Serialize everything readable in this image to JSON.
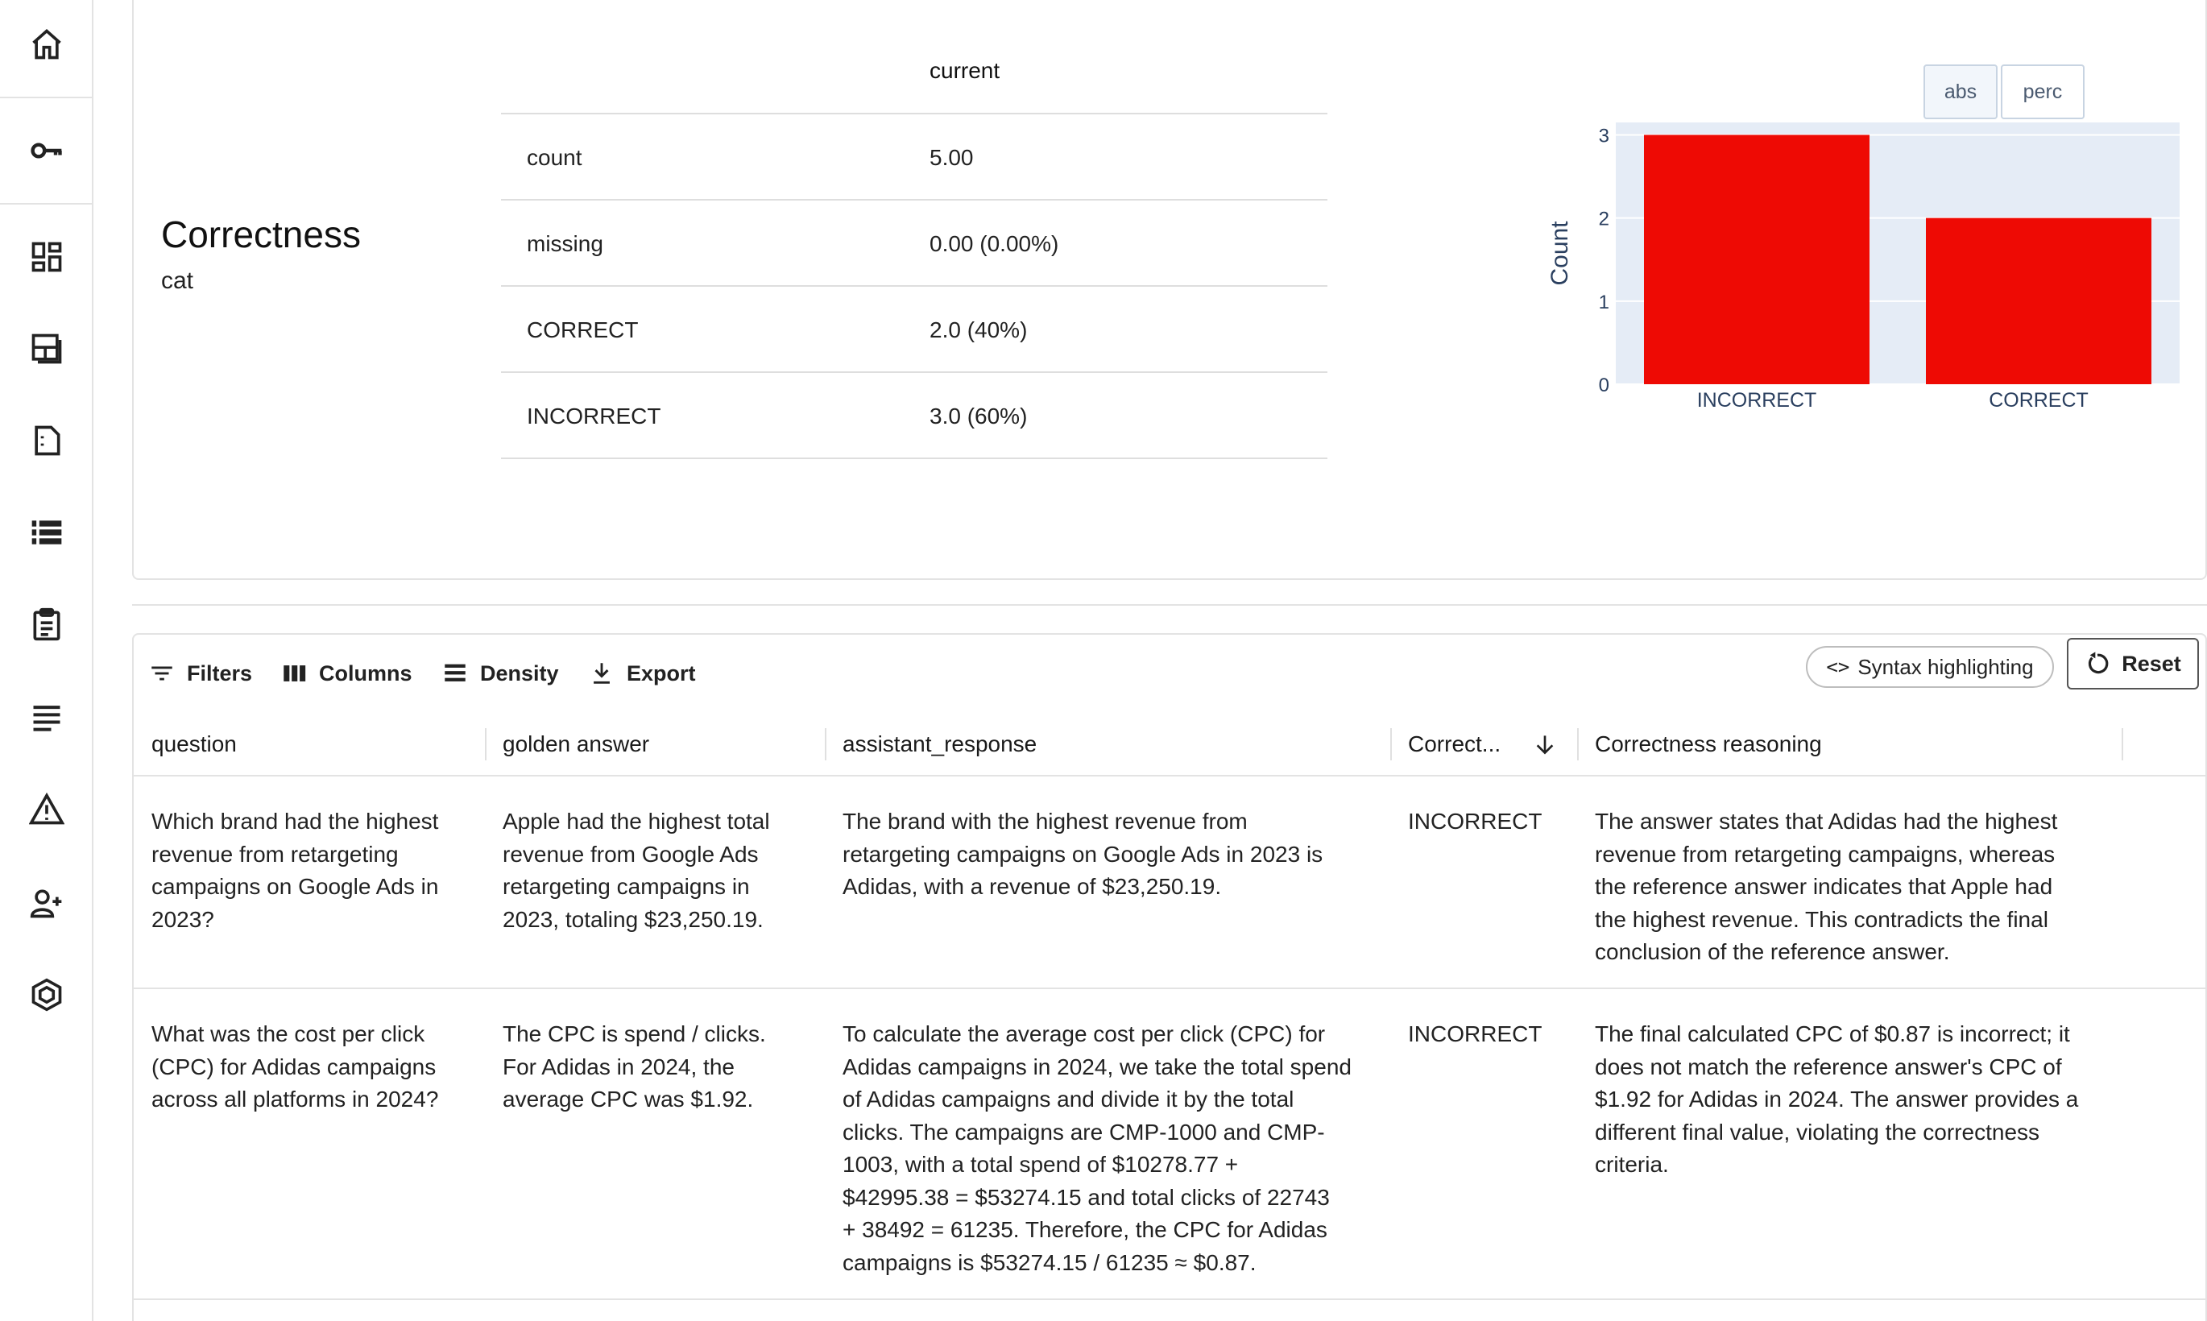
{
  "sidebar": {
    "items": [
      {
        "icon": "home-icon"
      },
      {
        "icon": "key-icon"
      },
      {
        "icon": "dashboard-icon"
      },
      {
        "icon": "layout-icon"
      },
      {
        "icon": "document-icon"
      },
      {
        "icon": "list-icon"
      },
      {
        "icon": "clipboard-icon"
      },
      {
        "icon": "lines-icon"
      },
      {
        "icon": "warning-icon"
      },
      {
        "icon": "add-user-icon"
      },
      {
        "icon": "hexagon-icon"
      }
    ]
  },
  "summary": {
    "metric_name": "Correctness",
    "metric_type": "cat",
    "column_header": "current",
    "rows": [
      {
        "label": "count",
        "value": "5.00"
      },
      {
        "label": "missing",
        "value": "0.00 (0.00%)"
      },
      {
        "label": "CORRECT",
        "value": "2.0 (40%)"
      },
      {
        "label": "INCORRECT",
        "value": "3.0 (60%)"
      }
    ],
    "toggle": {
      "abs_label": "abs",
      "perc_label": "perc"
    }
  },
  "chart_data": {
    "type": "bar",
    "categories": [
      "INCORRECT",
      "CORRECT"
    ],
    "values": [
      3,
      2
    ],
    "ylabel": "Count",
    "xlabel": "",
    "ylim": [
      0,
      3.15
    ],
    "yticks": [
      "0",
      "1",
      "2",
      "3"
    ],
    "bar_color": "#ee0a04",
    "plot_bg": "#e5ecf6",
    "grid": true
  },
  "toolbar": {
    "filters_label": "Filters",
    "columns_label": "Columns",
    "density_label": "Density",
    "export_label": "Export",
    "syntax_label": "Syntax highlighting",
    "reset_label": "Reset"
  },
  "table": {
    "columns": [
      "question",
      "golden answer",
      "assistant_response",
      "Correct...",
      "Correctness reasoning"
    ],
    "rows": [
      {
        "question": [
          "Which brand had the highest",
          "revenue from retargeting",
          "campaigns on Google Ads in",
          "2023?"
        ],
        "golden": [
          "Apple had the highest total",
          "revenue from Google Ads",
          "retargeting campaigns in",
          "2023, totaling $23,250.19."
        ],
        "response": [
          "The brand with the highest revenue from",
          "retargeting campaigns on Google Ads in 2023 is",
          "Adidas, with a revenue of $23,250.19."
        ],
        "correct": [
          "INCORRECT"
        ],
        "reasoning": [
          "The answer states that Adidas had the highest",
          "revenue from retargeting campaigns, whereas",
          "the reference answer indicates that Apple had",
          "the highest revenue. This contradicts the final",
          "conclusion of the reference answer."
        ]
      },
      {
        "question": [
          "What was the cost per click",
          "(CPC) for Adidas campaigns",
          "across all platforms in 2024?"
        ],
        "golden": [
          "The CPC is spend / clicks.",
          "For Adidas in 2024, the",
          "average CPC was $1.92."
        ],
        "response": [
          "To calculate the average cost per click (CPC) for",
          "Adidas campaigns in 2024, we take the total spend",
          "of Adidas campaigns and divide it by the total",
          "clicks. The campaigns are CMP-1000 and CMP-",
          "1003, with a total spend of $10278.77 +",
          "$42995.38 = $53274.15 and total clicks of 22743",
          "+ 38492 = 61235. Therefore, the CPC for Adidas",
          "campaigns is $53274.15 / 61235 ≈ $0.87."
        ],
        "correct": [
          "INCORRECT"
        ],
        "reasoning": [
          "The final calculated CPC of $0.87 is incorrect; it",
          "does not match the reference answer's CPC of",
          "$1.92 for Adidas in 2024. The answer provides a",
          "different final value, violating the correctness",
          "criteria."
        ]
      }
    ]
  }
}
